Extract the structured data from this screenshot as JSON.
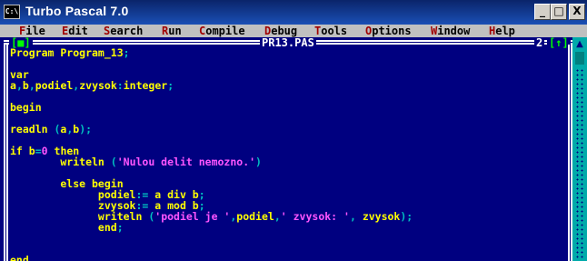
{
  "window": {
    "title": "Turbo Pascal 7.0",
    "icon_text": "C:\\",
    "minimize": "_",
    "maximize": "□",
    "close": "X"
  },
  "menubar": {
    "items": [
      {
        "hot": "F",
        "rest": "ile"
      },
      {
        "hot": "E",
        "rest": "dit"
      },
      {
        "hot": "S",
        "rest": "earch"
      },
      {
        "hot": "R",
        "rest": "un"
      },
      {
        "hot": "C",
        "rest": "ompile"
      },
      {
        "hot": "D",
        "rest": "ebug"
      },
      {
        "hot": "T",
        "rest": "ools"
      },
      {
        "hot": "O",
        "rest": "ptions"
      },
      {
        "hot": "W",
        "rest": "indow"
      },
      {
        "hot": "H",
        "rest": "elp"
      }
    ]
  },
  "editor": {
    "close_box": "[■]",
    "filename": "PR13.PAS",
    "window_number": "2",
    "zoom_box": "[↑]",
    "lines": [
      [
        {
          "t": "Program Program_13",
          "c": "kw"
        },
        {
          "t": ";",
          "c": "sym"
        }
      ],
      [],
      [
        {
          "t": "var",
          "c": "kw"
        }
      ],
      [
        {
          "t": "a",
          "c": "kw"
        },
        {
          "t": ",",
          "c": "sym"
        },
        {
          "t": "b",
          "c": "kw"
        },
        {
          "t": ",",
          "c": "sym"
        },
        {
          "t": "podiel",
          "c": "kw"
        },
        {
          "t": ",",
          "c": "sym"
        },
        {
          "t": "zvysok",
          "c": "kw"
        },
        {
          "t": ":",
          "c": "sym"
        },
        {
          "t": "integer",
          "c": "kw"
        },
        {
          "t": ";",
          "c": "sym"
        }
      ],
      [],
      [
        {
          "t": "begin",
          "c": "kw"
        }
      ],
      [],
      [
        {
          "t": "readln ",
          "c": "kw"
        },
        {
          "t": "(",
          "c": "sym"
        },
        {
          "t": "a",
          "c": "kw"
        },
        {
          "t": ",",
          "c": "sym"
        },
        {
          "t": "b",
          "c": "kw"
        },
        {
          "t": ");",
          "c": "sym"
        }
      ],
      [],
      [
        {
          "t": "if ",
          "c": "kw"
        },
        {
          "t": "b",
          "c": "kw"
        },
        {
          "t": "=",
          "c": "sym"
        },
        {
          "t": "0",
          "c": "num"
        },
        {
          "t": " then",
          "c": "kw"
        }
      ],
      [
        {
          "t": "        writeln ",
          "c": "kw"
        },
        {
          "t": "(",
          "c": "sym"
        },
        {
          "t": "'Nulou delit nemozno.'",
          "c": "str"
        },
        {
          "t": ")",
          "c": "sym"
        }
      ],
      [],
      [
        {
          "t": "        else begin",
          "c": "kw"
        }
      ],
      [
        {
          "t": "              podiel",
          "c": "kw"
        },
        {
          "t": ":= ",
          "c": "sym"
        },
        {
          "t": "a div b",
          "c": "kw"
        },
        {
          "t": ";",
          "c": "sym"
        }
      ],
      [
        {
          "t": "              zvysok",
          "c": "kw"
        },
        {
          "t": ":= ",
          "c": "sym"
        },
        {
          "t": "a mod b",
          "c": "kw"
        },
        {
          "t": ";",
          "c": "sym"
        }
      ],
      [
        {
          "t": "              writeln ",
          "c": "kw"
        },
        {
          "t": "(",
          "c": "sym"
        },
        {
          "t": "'podiel je '",
          "c": "str"
        },
        {
          "t": ",",
          "c": "sym"
        },
        {
          "t": "podiel",
          "c": "kw"
        },
        {
          "t": ",",
          "c": "sym"
        },
        {
          "t": "' zvysok: '",
          "c": "str"
        },
        {
          "t": ", ",
          "c": "sym"
        },
        {
          "t": "zvysok",
          "c": "kw"
        },
        {
          "t": ");",
          "c": "sym"
        }
      ],
      [
        {
          "t": "              end",
          "c": "kw"
        },
        {
          "t": ";",
          "c": "sym"
        }
      ],
      [],
      [],
      [
        {
          "t": "end",
          "c": "kw"
        },
        {
          "t": ".",
          "c": "sym"
        }
      ]
    ]
  },
  "colors": {
    "background": "#000080",
    "keyword": "#ffff00",
    "symbol": "#00c0c0",
    "string": "#ff55ff",
    "menubar": "#c0c0c0",
    "hotkey": "#a00000"
  }
}
